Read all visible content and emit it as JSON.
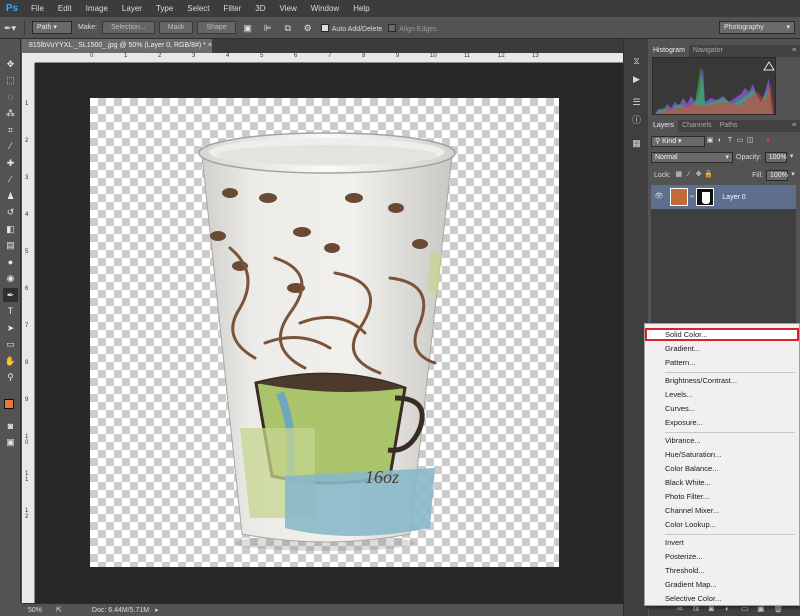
{
  "app": {
    "logo": "Ps"
  },
  "menubar": {
    "items": [
      "File",
      "Edit",
      "Image",
      "Layer",
      "Type",
      "Select",
      "Filter",
      "3D",
      "View",
      "Window",
      "Help"
    ]
  },
  "options": {
    "mode_value": "Path",
    "make_label": "Make:",
    "selection_btn": "Selection...",
    "mask_btn": "Mask",
    "shape_btn": "Shape",
    "auto_add_delete": "Auto Add/Delete",
    "align_edges": "Align Edges",
    "workspace": "Photography"
  },
  "document": {
    "tab_title": "815lbVuYYXL._SL1500_.jpg @ 50% (Layer 0, RGB/8#) *",
    "ruler_left_labels": [
      "1",
      "2",
      "3",
      "4",
      "5",
      "6",
      "7",
      "8",
      "9",
      "1 0",
      "1 1",
      "1 2"
    ],
    "ruler_top_labels": [
      "0",
      "1",
      "2",
      "3",
      "4",
      "5",
      "6",
      "7",
      "8",
      "9",
      "10",
      "11",
      "12",
      "13"
    ],
    "cup_size": "16oz"
  },
  "status": {
    "zoom": "50%",
    "doc_info": "Doc: 6.44M/5.71M"
  },
  "histogram_panel": {
    "tabs": [
      "Histogram",
      "Navigator"
    ]
  },
  "layers_panel": {
    "tabs": [
      "Layers",
      "Channels",
      "Paths"
    ],
    "filter_kind": "Kind",
    "blend_mode": "Normal",
    "opacity_label": "Opacity:",
    "opacity_value": "100%",
    "lock_label": "Lock:",
    "fill_label": "Fill:",
    "fill_value": "100%",
    "layer_name": "Layer 0"
  },
  "adjustment_menu": {
    "items": [
      "Solid Color...",
      "Gradient...",
      "Pattern...",
      "Brightness/Contrast...",
      "Levels...",
      "Curves...",
      "Exposure...",
      "Vibrance...",
      "Hue/Saturation...",
      "Color Balance...",
      "Black  White...",
      "Photo Filter...",
      "Channel Mixer...",
      "Color Lookup...",
      "Invert",
      "Posterize...",
      "Threshold...",
      "Gradient Map...",
      "Selective Color..."
    ],
    "highlighted": "Solid Color..."
  },
  "colors": {
    "foreground": "#e8763f",
    "background": "#1e5aa8",
    "highlight_border": "#d9232a",
    "layer_selected": "#5d6f8d"
  }
}
